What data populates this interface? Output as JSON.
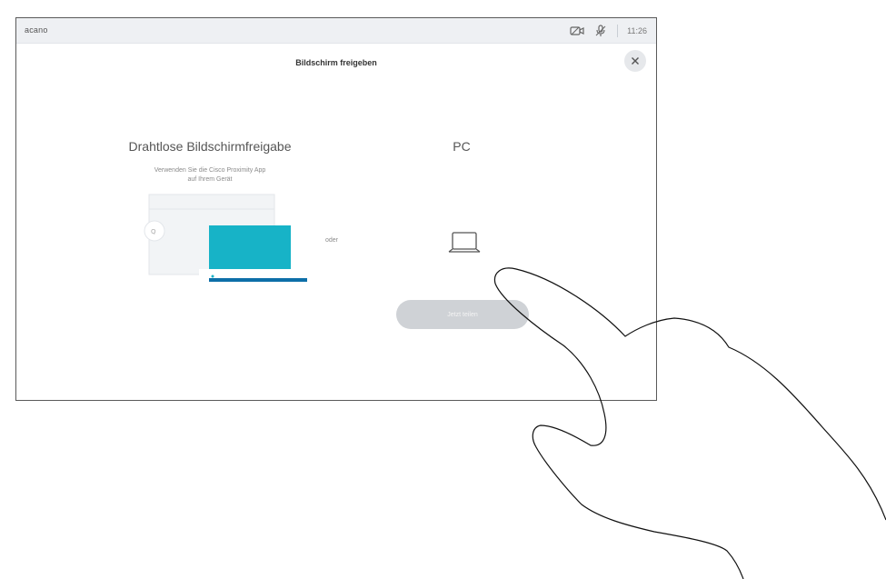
{
  "statusbar": {
    "left_text": "acano",
    "clock": "11:26"
  },
  "dialog": {
    "title": "Bildschirm freigeben",
    "close_icon": "close-icon"
  },
  "wireless": {
    "title": "Drahtlose Bildschirmfreigabe",
    "description_line1": "Verwenden Sie die Cisco Proximity App",
    "description_line2": "auf Ihrem Gerät"
  },
  "separator": {
    "label": "oder"
  },
  "pc": {
    "title": "PC"
  },
  "actions": {
    "share_label": "Jetzt teilen"
  },
  "colors": {
    "accent_teal": "#17b3c7",
    "accent_blue": "#0d6fa8",
    "button_bg": "#cfd2d6",
    "statusbar_bg": "#eef0f3"
  }
}
